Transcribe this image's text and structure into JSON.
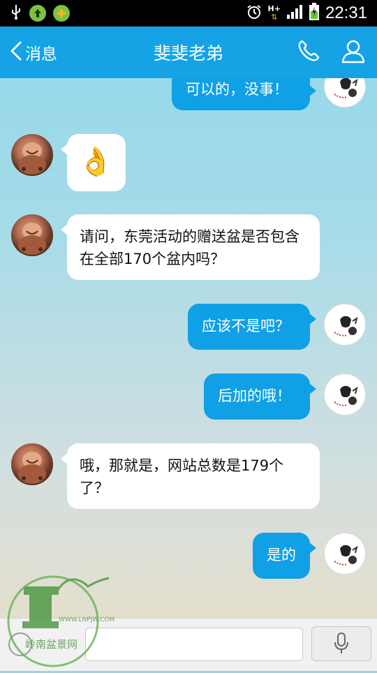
{
  "status_bar": {
    "time": "22:31",
    "network": "H+"
  },
  "nav": {
    "back_label": "消息",
    "title": "斐斐老弟"
  },
  "messages": [
    {
      "direction": "out",
      "text": "可以的，没事！"
    },
    {
      "direction": "in",
      "text": "👌"
    },
    {
      "direction": "in",
      "text": "请问，东莞活动的赠送盆是否包含在全部170个盆内吗？"
    },
    {
      "direction": "out",
      "text": "应该不是吧？"
    },
    {
      "direction": "out",
      "text": "后加的哦！"
    },
    {
      "direction": "in",
      "text": "哦，那就是，网站总数是179个了？"
    },
    {
      "direction": "out",
      "text": "是的"
    }
  ],
  "watermark": {
    "url": "WWW.LNPJW.COM",
    "name": "岭南盆景网"
  },
  "colors": {
    "nav_bg": "#15a3e6",
    "out_bubble": "#10a0e6",
    "in_bubble": "#ffffff"
  }
}
